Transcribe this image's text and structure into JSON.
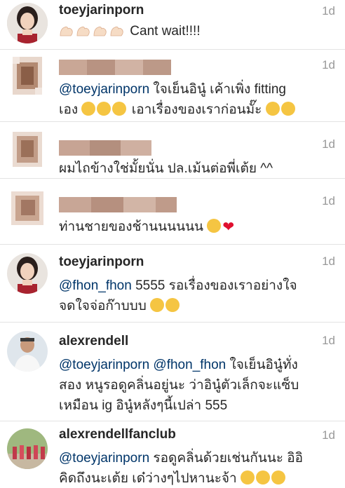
{
  "comments": [
    {
      "username": "toeyjarinporn",
      "time": "1d",
      "text": "Cant wait!!!!"
    },
    {
      "username": "",
      "time": "1d",
      "mention": "@toeyjarinporn",
      "line1": " ใจเย็นอินู๋ เค้าเพิ่ง fitting",
      "line2a": "เอง ",
      "line2b": " เอาเรื่องของเราก่อนมั๊ะ "
    },
    {
      "username": "",
      "time": "1d",
      "text": "ผมไถข้างใช่มั้ยนั่น ปล.เม้นต่อพี่เต้ย ^^"
    },
    {
      "username": "",
      "time": "1d",
      "text": "ท่านชายของช้านนนนนน "
    },
    {
      "username": "toeyjarinporn",
      "time": "1d",
      "mention": "@fhon_fhon",
      "line1": " 5555 รอเรื่องของเราอย่างใจ",
      "line2": "จดใจจ่อก๊าบบบ "
    },
    {
      "username": "alexrendell",
      "time": "1d",
      "mention1": "@toeyjarinporn",
      "mention2": "@fhon_fhon",
      "line1": " ใจเย็นอินู๋ทั่ง",
      "line2": "สอง หนูรอดูคลิ่นอยู่นะ ว่าอินู๋ตัวเล็กจะแซ็บ",
      "line3": "เหมือน ig อินู๋หลังๆนี้เปล่า 555"
    },
    {
      "username": "alexrendellfanclub",
      "time": "1d",
      "mention": "@toeyjarinporn",
      "line1": "  รอดูคลิ่นด้วยเช่นกันนะ อิอิ",
      "line2": "คิดถึงนะเต้ย เด๋ว่างๆไปหานะจ้า "
    }
  ],
  "colors": {
    "text": "#262626",
    "mention": "#003569",
    "time": "#999999",
    "divider": "#e3e3e3",
    "heart": "#e0102f"
  },
  "icons": [
    "flexed-biceps-emoji",
    "winking-tongue-emoji",
    "kiss-emoji",
    "tears-of-joy-emoji",
    "grinning-emoji",
    "red-heart-emoji"
  ]
}
